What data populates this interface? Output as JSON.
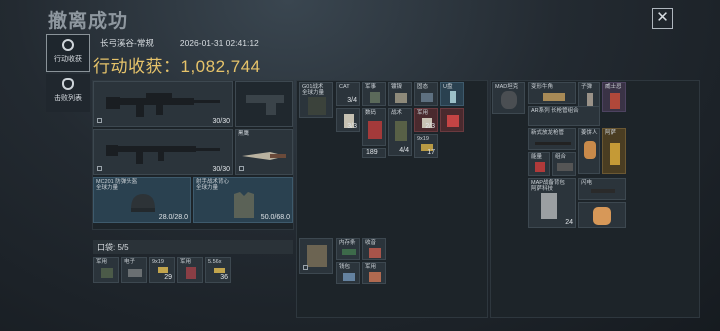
{
  "header": {
    "title": "撤离成功",
    "close_icon": "close-icon"
  },
  "sidebar": [
    {
      "label": "行动收获",
      "icon": "target-icon",
      "active": true
    },
    {
      "label": "击败列表",
      "icon": "skull-icon",
      "active": false
    }
  ],
  "meta": {
    "map": "长弓溪谷-常规",
    "datetime": "2026-01-31 02:41:12"
  },
  "haul": {
    "label": "行动收获：",
    "value": "1,082,744"
  },
  "gear": {
    "weapon1": {
      "ammo": "30/30"
    },
    "weapon2": {
      "ammo": "30/30"
    },
    "melee": {
      "label": "黑鹰"
    },
    "helmet": {
      "label": "MC201 防弹头盔",
      "sub": "全球力量",
      "durability": "28.0/28.0"
    },
    "armor": {
      "label": "射手战术背心",
      "sub": "全球力量",
      "durability": "50.0/68.0"
    }
  },
  "pocket": {
    "label": "口袋: 5/5",
    "items": [
      {
        "label": "军用"
      },
      {
        "label": "电子"
      },
      {
        "label": "9x19",
        "count": "29"
      },
      {
        "label": "军用"
      },
      {
        "label": "5.56x",
        "count": "36"
      }
    ]
  },
  "chest_rig": {
    "items": [
      {
        "label": "G01战术",
        "sub": "全球力量"
      },
      {
        "label": "CAT",
        "count": "3/4"
      },
      {
        "label": "军事",
        "sub": ""
      },
      {
        "label": "镀镍",
        "sub": ""
      },
      {
        "label": "固态",
        "sub": ""
      },
      {
        "label": "U盘",
        "sub": ""
      },
      {
        "label": "",
        "count": "3/3"
      },
      {
        "label": "数码",
        "sub": ""
      },
      {
        "label": "战术",
        "count": "4/4"
      },
      {
        "label": "军用",
        "count": "2/3"
      },
      {
        "label": "",
        "count": "189"
      },
      {
        "label": "9x19",
        "count": "17"
      }
    ]
  },
  "bag_small": {
    "label": "",
    "items": [
      {
        "label": "内存条"
      },
      {
        "label": "收音"
      },
      {
        "label": "钱包"
      },
      {
        "label": "军用"
      }
    ]
  },
  "backpack": {
    "items": [
      {
        "label": "MAD坦克"
      },
      {
        "label": "变形牛角"
      },
      {
        "label": "子弹"
      },
      {
        "label": "威士忌"
      },
      {
        "label": "AR系列 长枪管组合"
      },
      {
        "label": "新式放龙枪管"
      },
      {
        "label": "姜饼人"
      },
      {
        "label": "阿萨"
      },
      {
        "label": "能量"
      },
      {
        "label": "组合"
      },
      {
        "label": "MAP"
      },
      {
        "label": "MAP战备背包",
        "sub": "阿萨科技",
        "count": "24"
      },
      {
        "label": "闪电"
      }
    ]
  }
}
